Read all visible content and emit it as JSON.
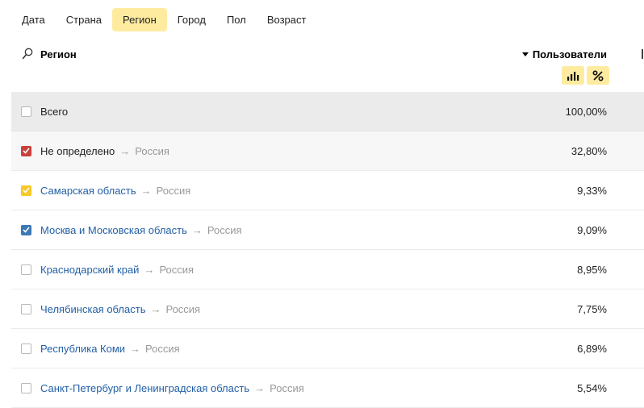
{
  "tabs": [
    {
      "label": "Дата"
    },
    {
      "label": "Страна"
    },
    {
      "label": "Регион"
    },
    {
      "label": "Город"
    },
    {
      "label": "Пол"
    },
    {
      "label": "Возраст"
    }
  ],
  "active_tab": "Регион",
  "header": {
    "dimension_label": "Регион",
    "metric_label": "Пользователи",
    "icons": {
      "search": "search-icon",
      "sort": "sort-desc-icon",
      "chart": "bar-chart-icon",
      "percent": "percent-icon"
    }
  },
  "table": {
    "total": {
      "label": "Всего",
      "value": "100,00%"
    },
    "rows": [
      {
        "region": "Не определено",
        "country": "Россия",
        "value": "32,80%",
        "checked": true,
        "color": "#c8413a",
        "is_link": false
      },
      {
        "region": "Самарская область",
        "country": "Россия",
        "value": "9,33%",
        "checked": true,
        "color": "#f6c829",
        "is_link": true
      },
      {
        "region": "Москва и Московская область",
        "country": "Россия",
        "value": "9,09%",
        "checked": true,
        "color": "#3c78b5",
        "is_link": true
      },
      {
        "region": "Краснодарский край",
        "country": "Россия",
        "value": "8,95%",
        "checked": false,
        "is_link": true
      },
      {
        "region": "Челябинская область",
        "country": "Россия",
        "value": "7,75%",
        "checked": false,
        "is_link": true
      },
      {
        "region": "Республика Коми",
        "country": "Россия",
        "value": "6,89%",
        "checked": false,
        "is_link": true
      },
      {
        "region": "Санкт-Петербург и Ленинградская область",
        "country": "Россия",
        "value": "5,54%",
        "checked": false,
        "is_link": true
      }
    ],
    "arrow_glyph": "→"
  },
  "colors": {
    "accent": "#ffeba0",
    "link": "#2360a6",
    "muted": "#999999"
  }
}
